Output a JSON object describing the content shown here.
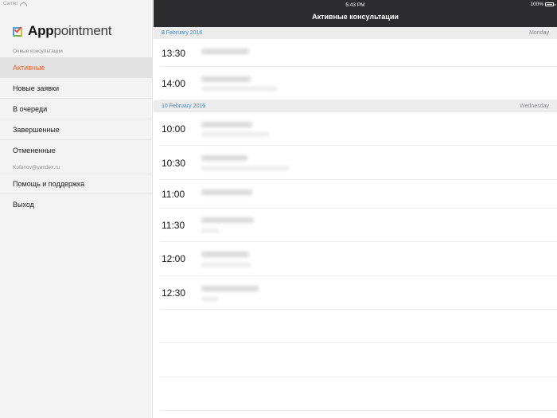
{
  "status": {
    "carrier": "Carrier",
    "time": "5:43 PM",
    "battery": "100%"
  },
  "app": {
    "brand_part1": "App",
    "brand_part2": "ointment",
    "brand_p": "p"
  },
  "sidebar": {
    "section1": "Очные консультации",
    "items": [
      {
        "label": "Активные"
      },
      {
        "label": "Новые заявки"
      },
      {
        "label": "В очереди"
      },
      {
        "label": "Завершенные"
      },
      {
        "label": "Отмененные"
      }
    ],
    "account": "Kofanov@yandex.ru",
    "items2": [
      {
        "label": "Помощь и поддержка"
      },
      {
        "label": "Выход"
      }
    ]
  },
  "main": {
    "title": "Активные консультации",
    "groups": [
      {
        "date": "8 February 2016",
        "weekday": "Monday",
        "rows": [
          {
            "time": "13:30"
          },
          {
            "time": "14:00"
          }
        ]
      },
      {
        "date": "10 February 2016",
        "weekday": "Wednesday",
        "rows": [
          {
            "time": "10:00"
          },
          {
            "time": "10:30"
          },
          {
            "time": "11:00"
          },
          {
            "time": "11:30"
          },
          {
            "time": "12:00"
          },
          {
            "time": "12:30"
          }
        ]
      }
    ]
  },
  "colors": {
    "accent": "#e8612c",
    "date_blue": "#3c8fd0",
    "topbar": "#2c2c2e"
  }
}
